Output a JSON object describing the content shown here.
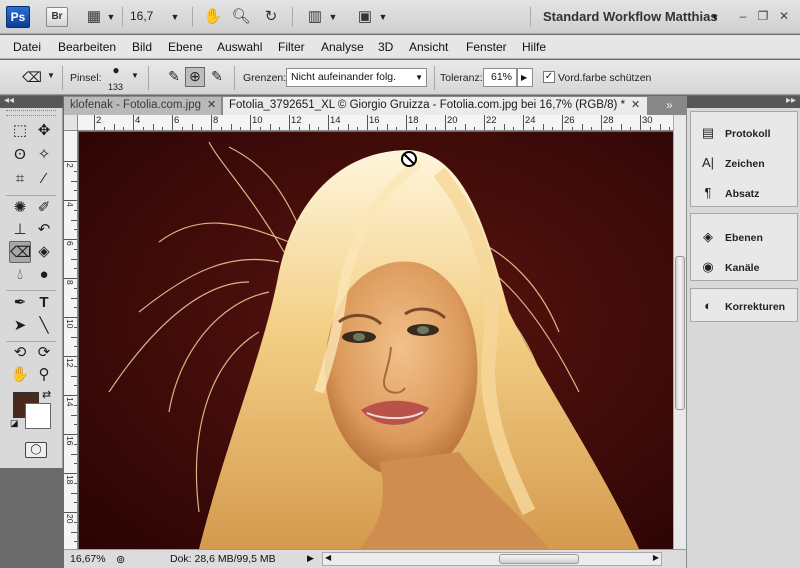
{
  "app": {
    "logo_ps": "Ps",
    "logo_br": "Br",
    "zoom": "16,7",
    "workspace": "Standard Workflow Matthias"
  },
  "menu": [
    "Datei",
    "Bearbeiten",
    "Bild",
    "Ebene",
    "Auswahl",
    "Filter",
    "Analyse",
    "3D",
    "Ansicht",
    "Fenster",
    "Hilfe"
  ],
  "options": {
    "brush_label": "Pinsel:",
    "brush_size": "133",
    "limits_label": "Grenzen:",
    "limits_value": "Nicht aufeinander folg.",
    "tolerance_label": "Toleranz:",
    "tolerance_value": "61%",
    "protect_fg_label": "Vord.farbe schützen",
    "protect_fg_checked": "✓"
  },
  "tabs": [
    {
      "label": "klofenak - Fotolia.com.jpg",
      "active": false
    },
    {
      "label": "Fotolia_3792651_XL © Giorgio Gruizza - Fotolia.com.jpg bei 16,7% (RGB/8) *",
      "active": true
    }
  ],
  "tab_overflow": "»",
  "ruler_h": [
    "2",
    "4",
    "6",
    "8",
    "10",
    "12",
    "14",
    "16",
    "18",
    "20",
    "22",
    "24",
    "26",
    "28",
    "30"
  ],
  "ruler_v": [
    "2",
    "4",
    "6",
    "8",
    "10",
    "12",
    "14",
    "16",
    "18",
    "20"
  ],
  "colors": {
    "foreground": "#4a2a1c",
    "background": "#ffffff",
    "photo_bg": "#3b0806"
  },
  "status": {
    "zoom": "16,67%",
    "doc_size": "Dok: 28,6 MB/99,5 MB"
  },
  "panels": {
    "group1": [
      {
        "label": "Protokoll",
        "icon": "history-icon"
      },
      {
        "label": "Zeichen",
        "icon": "character-icon"
      },
      {
        "label": "Absatz",
        "icon": "paragraph-icon"
      }
    ],
    "group2": [
      {
        "label": "Ebenen",
        "icon": "layers-icon"
      },
      {
        "label": "Kanäle",
        "icon": "channels-icon"
      }
    ],
    "group3": [
      {
        "label": "Korrekturen",
        "icon": "adjustments-icon"
      }
    ]
  }
}
